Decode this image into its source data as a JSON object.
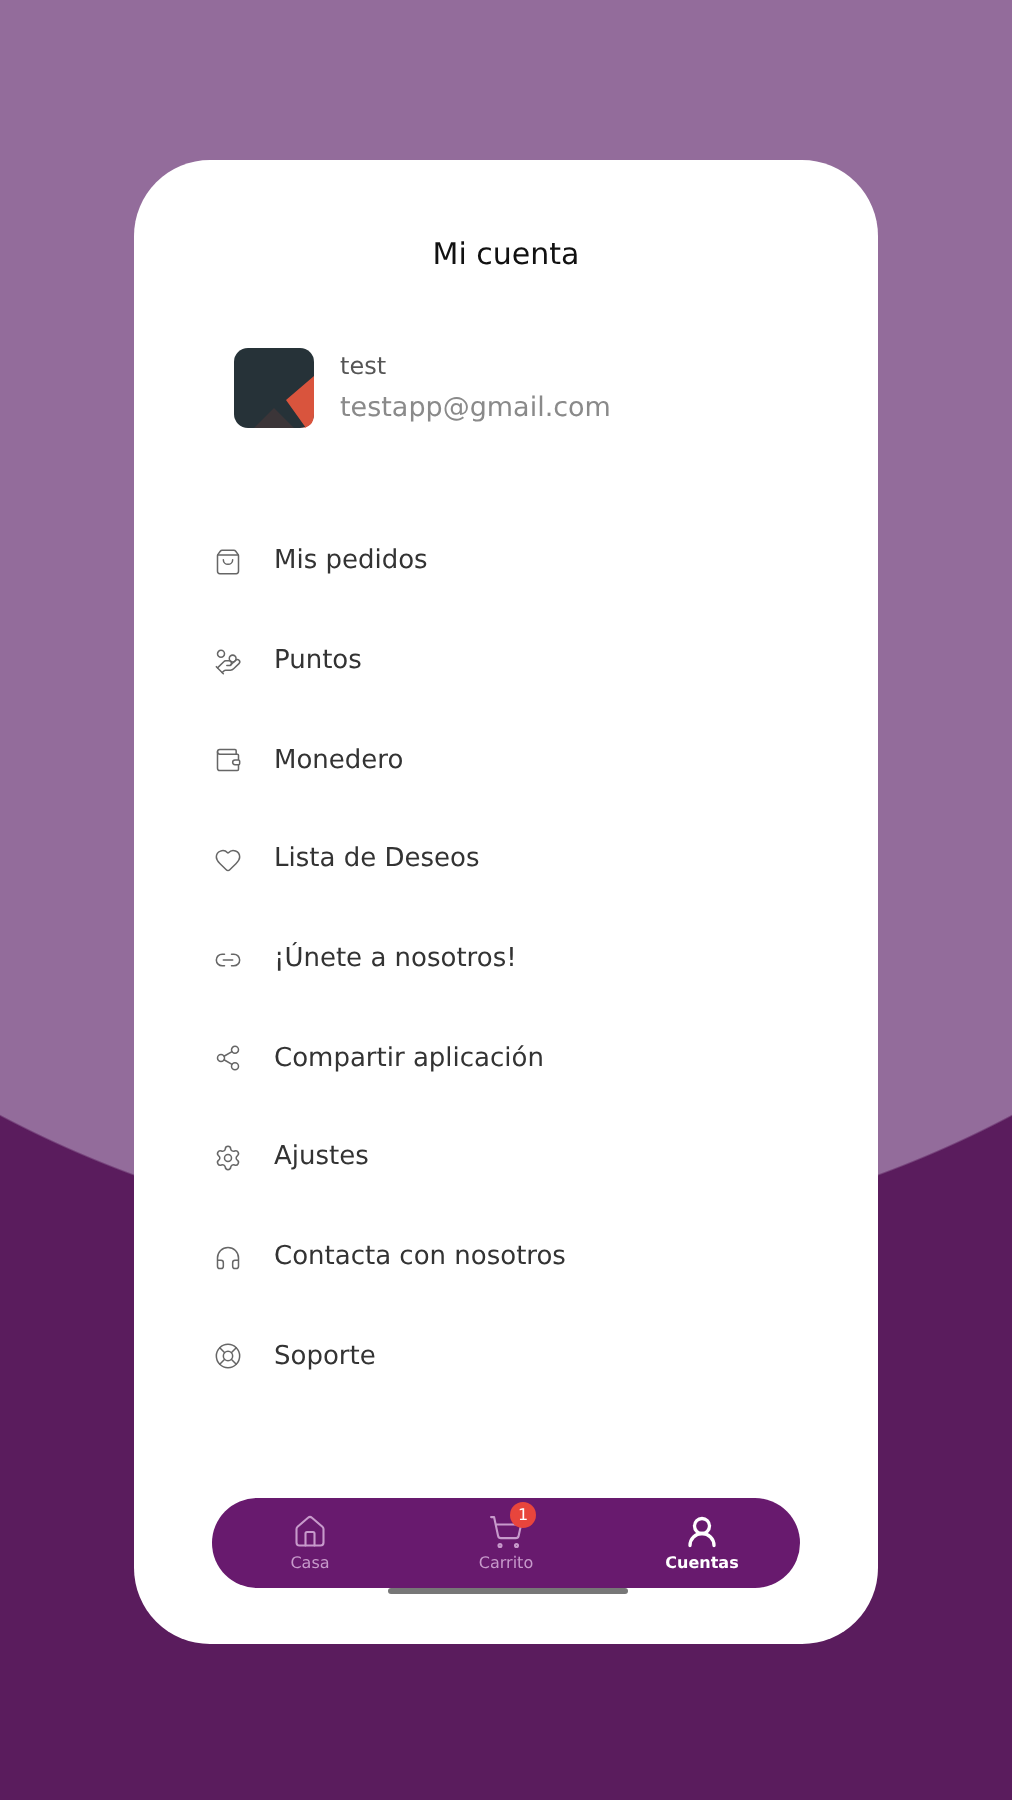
{
  "title": "Mi cuenta",
  "profile": {
    "name": "test",
    "email": "testapp@gmail.com"
  },
  "menu": [
    {
      "label": "Mis pedidos"
    },
    {
      "label": "Puntos"
    },
    {
      "label": "Monedero"
    },
    {
      "label": "Lista de Deseos"
    },
    {
      "label": "¡Únete a nosotros!"
    },
    {
      "label": "Compartir aplicación"
    },
    {
      "label": "Ajustes"
    },
    {
      "label": "Contacta con nosotros"
    },
    {
      "label": "Soporte"
    }
  ],
  "nav": [
    {
      "label": "Casa",
      "selected": false
    },
    {
      "label": "Carrito",
      "selected": false,
      "badge": "1"
    },
    {
      "label": "Cuentas",
      "selected": true
    }
  ]
}
